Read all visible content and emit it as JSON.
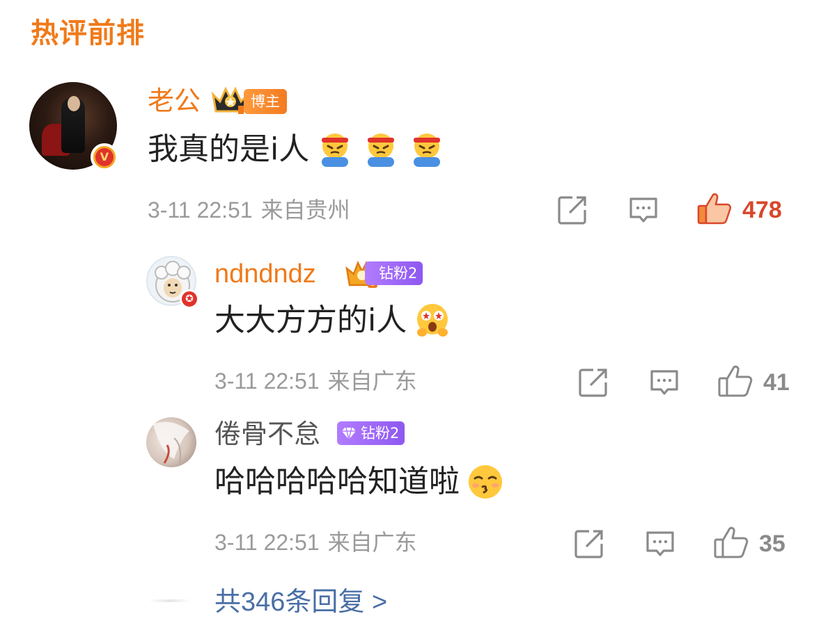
{
  "section_title": "热评前排",
  "main_comment": {
    "author": "老公",
    "badge_label": "博主",
    "text": "我真的是i人",
    "emojis": [
      "angry-headband-emoji",
      "angry-headband-emoji",
      "angry-headband-emoji"
    ],
    "date": "3-11 22:51",
    "location": "来自贵州",
    "likes": "478",
    "liked": true
  },
  "replies": [
    {
      "author": "ndndndz",
      "fan_badge": "钻粉2",
      "text": "大大方方的i人",
      "emoji": "star-eyes-emoji",
      "date": "3-11 22:51",
      "location": "来自广东",
      "likes": "41"
    },
    {
      "author": "倦骨不怠",
      "fan_badge": "钻粉2",
      "text": "哈哈哈哈哈知道啦",
      "emoji": "kiss-emoji",
      "date": "3-11 22:51",
      "location": "来自广东",
      "likes": "35"
    }
  ],
  "more_replies": "共346条回复 >",
  "colors": {
    "accent_orange": "#f07a1a",
    "like_red": "#d8472b",
    "meta_gray": "#9a9a9a",
    "link_blue": "#4a6fa5",
    "fan_purple": "#9b66f5"
  }
}
